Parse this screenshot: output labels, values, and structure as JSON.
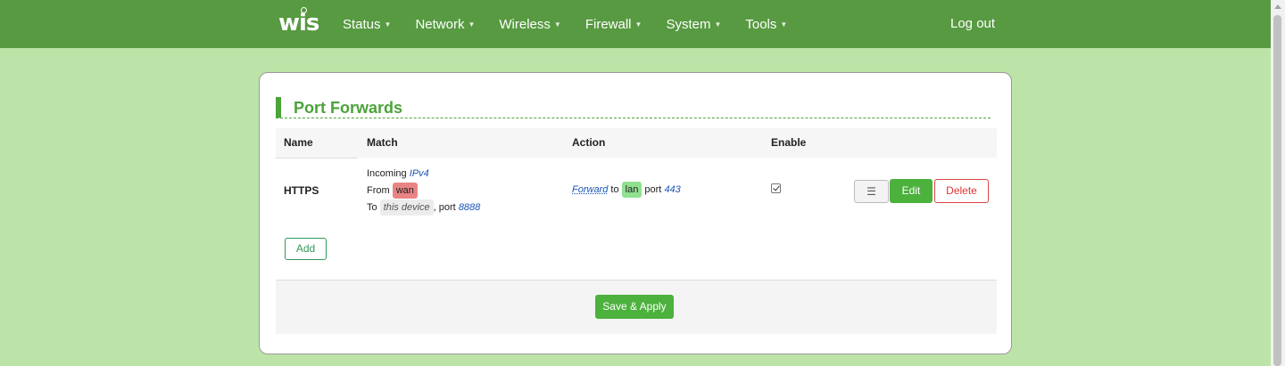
{
  "nav": {
    "logo": "wis",
    "menu": [
      {
        "label": "Status"
      },
      {
        "label": "Network"
      },
      {
        "label": "Wireless"
      },
      {
        "label": "Firewall"
      },
      {
        "label": "System"
      },
      {
        "label": "Tools"
      }
    ],
    "logout": "Log out"
  },
  "section": {
    "title": "Port Forwards"
  },
  "table": {
    "headers": {
      "name": "Name",
      "match": "Match",
      "action": "Action",
      "enable": "Enable"
    },
    "rows": [
      {
        "name": "HTTPS",
        "match": {
          "incoming_label": "Incoming",
          "protocol": "IPv4",
          "from_label": "From",
          "from_zone": "wan",
          "to_label": "To",
          "to_target": "this device",
          "port_label": ", port",
          "port": "8888"
        },
        "action": {
          "forward": "Forward",
          "to_label": "to",
          "zone": "lan",
          "port_label": "port",
          "port": "443"
        },
        "enabled": true,
        "buttons": {
          "drag": "☰",
          "edit": "Edit",
          "delete": "Delete"
        }
      }
    ]
  },
  "add_button": "Add",
  "save_apply": "Save & Apply",
  "colors": {
    "navbar": "#579a41",
    "page_bg": "#bde4a8",
    "accent": "#4ca33a",
    "button_green": "#4cb13d",
    "wan_tag": "#e98484",
    "lan_tag": "#90e090",
    "delete": "#dd3333"
  }
}
